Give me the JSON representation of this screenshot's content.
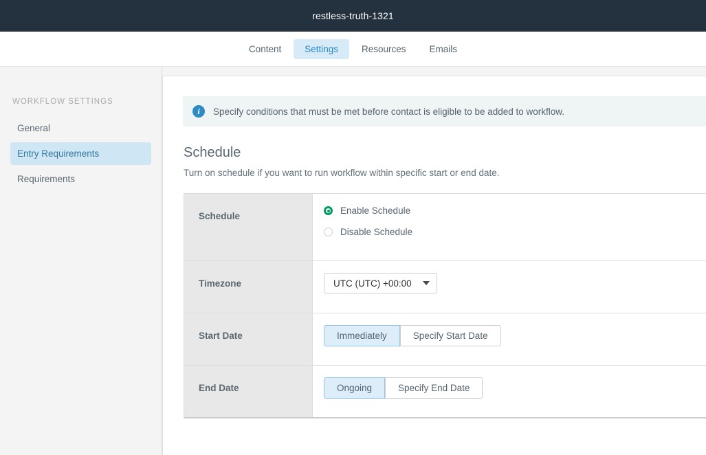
{
  "topbar": {
    "title": "restless-truth-1321"
  },
  "tabs": [
    {
      "label": "Content",
      "active": false
    },
    {
      "label": "Settings",
      "active": true
    },
    {
      "label": "Resources",
      "active": false
    },
    {
      "label": "Emails",
      "active": false
    }
  ],
  "sidebar": {
    "heading": "WORKFLOW SETTINGS",
    "items": [
      {
        "label": "General",
        "active": false
      },
      {
        "label": "Entry Requirements",
        "active": true
      },
      {
        "label": "Requirements",
        "active": false
      }
    ]
  },
  "banner": {
    "icon": "info-icon",
    "text": "Specify conditions that must be met before contact is eligible to be added to workflow."
  },
  "section": {
    "title": "Schedule",
    "subtitle": "Turn on schedule if you want to run workflow within specific start or end date."
  },
  "settings": {
    "schedule": {
      "label": "Schedule",
      "options": [
        {
          "label": "Enable Schedule",
          "checked": true
        },
        {
          "label": "Disable Schedule",
          "checked": false
        }
      ]
    },
    "timezone": {
      "label": "Timezone",
      "value": "UTC (UTC) +00:00"
    },
    "start_date": {
      "label": "Start Date",
      "buttons": [
        {
          "label": "Immediately",
          "selected": true
        },
        {
          "label": "Specify Start Date",
          "selected": false
        }
      ]
    },
    "end_date": {
      "label": "End Date",
      "buttons": [
        {
          "label": "Ongoing",
          "selected": true
        },
        {
          "label": "Specify End Date",
          "selected": false
        }
      ]
    }
  },
  "colors": {
    "topbar_bg": "#24323f",
    "tab_active_bg": "#d6eaf8",
    "tab_active_text": "#2b88c4",
    "sidebar_active_bg": "#cfe6f5",
    "sidebar_active_text": "#35789e",
    "banner_bg": "#eef5f4",
    "info_icon": "#2e8bc4",
    "radio_checked": "#009b61",
    "toggle_selected_bg": "#ddeefa",
    "toggle_selected_border": "#92c7e8",
    "row_label_bg": "#e8e8e8"
  }
}
